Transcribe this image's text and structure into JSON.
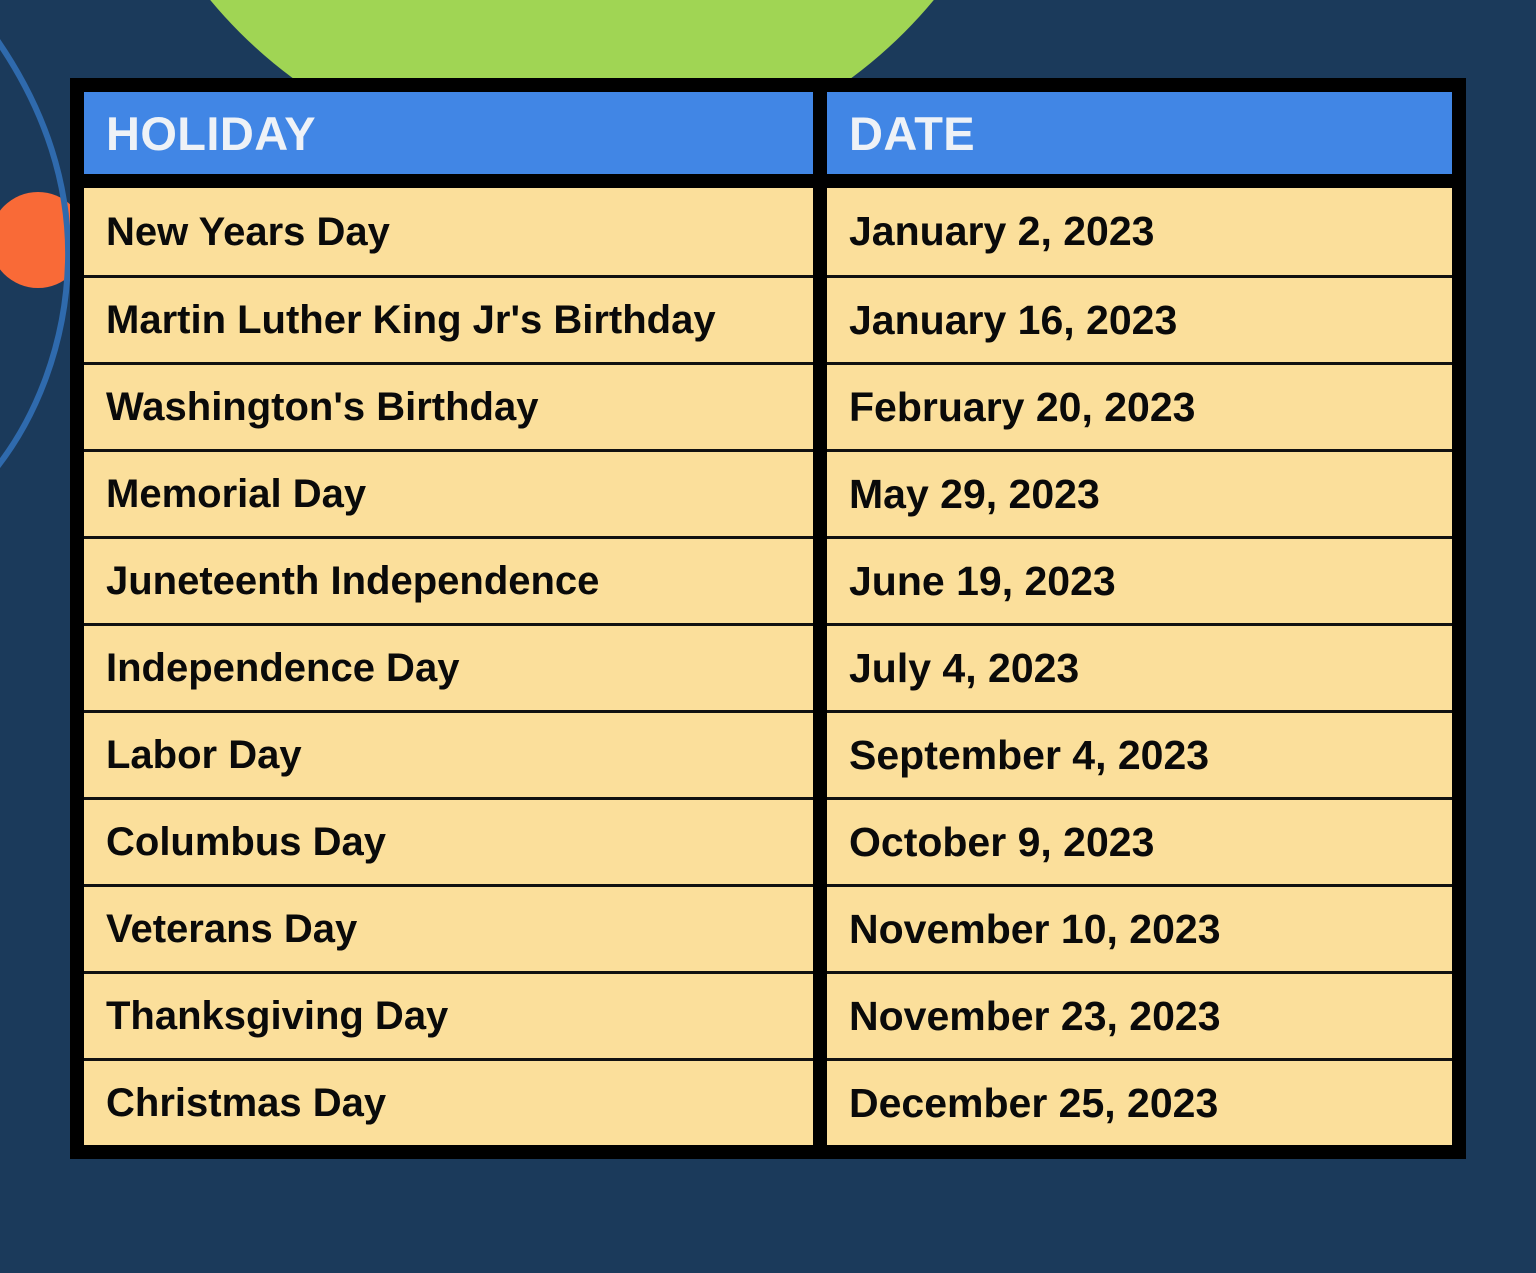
{
  "palette": {
    "background_navy": "#1b3a5b",
    "header_blue": "#4186e5",
    "cell_yellow": "#fbdf9b",
    "accent_green": "#a0d554",
    "accent_orange": "#f96a37",
    "arc_blue": "#2f6aad",
    "border_black": "#000000",
    "header_text": "#eef2f7",
    "cell_text": "#0a0a0a"
  },
  "decorations": [
    {
      "name": "green-circle",
      "shape": "circle",
      "color": "#a0d554"
    },
    {
      "name": "orange-circle",
      "shape": "circle",
      "color": "#f96a37"
    },
    {
      "name": "blue-arc",
      "shape": "arc",
      "color": "#2f6aad"
    }
  ],
  "table": {
    "columns": [
      {
        "key": "holiday",
        "label": "HOLIDAY"
      },
      {
        "key": "date",
        "label": "DATE"
      }
    ],
    "rows": [
      {
        "holiday": "New Years Day",
        "date": "January 2, 2023"
      },
      {
        "holiday": "Martin Luther King Jr's Birthday",
        "date": "January 16, 2023"
      },
      {
        "holiday": "Washington's Birthday",
        "date": "February 20, 2023"
      },
      {
        "holiday": "Memorial Day",
        "date": "May 29, 2023"
      },
      {
        "holiday": "Juneteenth Independence",
        "date": "June 19, 2023"
      },
      {
        "holiday": "Independence Day",
        "date": "July 4, 2023"
      },
      {
        "holiday": "Labor Day",
        "date": "September 4, 2023"
      },
      {
        "holiday": "Columbus Day",
        "date": "October 9, 2023"
      },
      {
        "holiday": "Veterans Day",
        "date": "November 10, 2023"
      },
      {
        "holiday": "Thanksgiving Day",
        "date": "November 23, 2023"
      },
      {
        "holiday": "Christmas Day",
        "date": "December 25, 2023"
      }
    ]
  }
}
